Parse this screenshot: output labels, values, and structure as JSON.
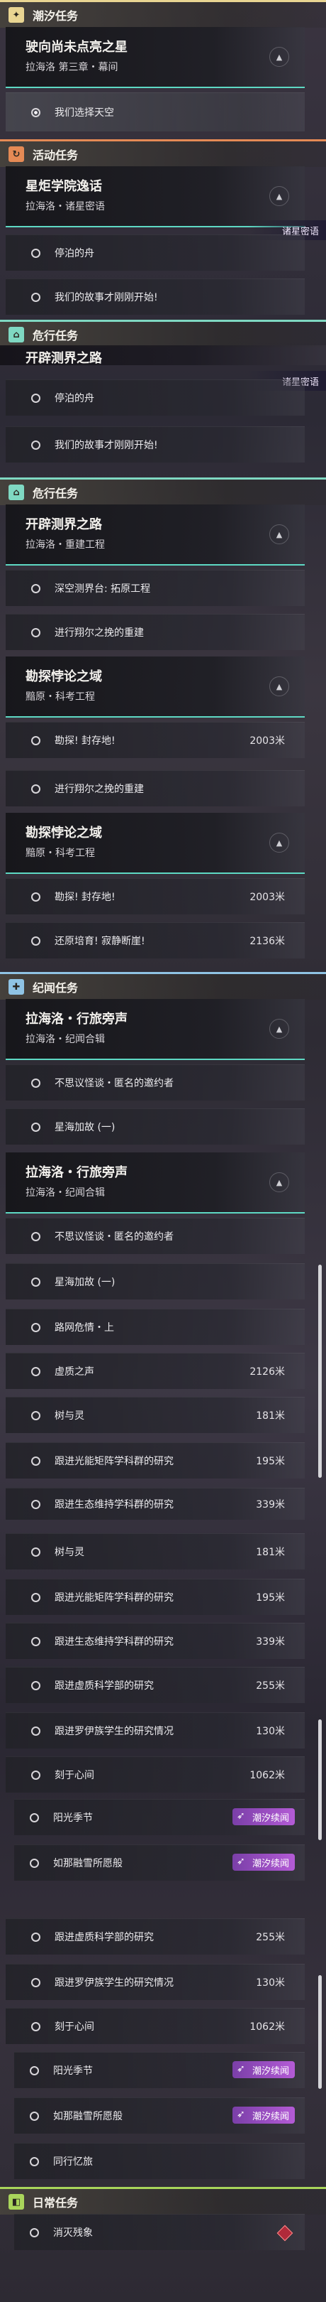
{
  "sections": {
    "tide": {
      "title": "潮汐任务",
      "icon": "✦"
    },
    "activity": {
      "title": "活动任务",
      "icon": "↻"
    },
    "danger": {
      "title": "危行任务",
      "icon": "⌂"
    },
    "chronicle": {
      "title": "纪闻任务",
      "icon": "✚"
    },
    "daily": {
      "title": "日常任务",
      "icon": "◧"
    }
  },
  "cards": {
    "c1": {
      "title": "驶向尚未点亮之星",
      "sub": "拉海洛 第三章・幕间"
    },
    "c2": {
      "title": "星炬学院逸话",
      "sub": "拉海洛・诸星密语"
    },
    "c3": {
      "title": "开辟测界之路",
      "sub": "拉海洛・重建工程"
    },
    "c4": {
      "title": "勘探悖论之域",
      "sub": "黯原・科考工程"
    },
    "c5": {
      "title": "勘探悖论之域",
      "sub": "黯原・科考工程"
    },
    "c6": {
      "title": "拉海洛・行旅旁声",
      "sub": "拉海洛・纪闻合辑"
    },
    "c7": {
      "title": "拉海洛・行旅旁声",
      "sub": "拉海洛・纪闻合辑"
    }
  },
  "partial": {
    "kaipi": "开辟测界之路",
    "xingyu": "诸星密语"
  },
  "rows": {
    "r_choose": "我们选择天空",
    "r_boat": "停泊的舟",
    "r_story": "我们的故事才刚刚开始!",
    "r_deep": "深空测界台: 拓原工程",
    "r_rebuild": "进行翔尔之挽的重建",
    "r_explore": "勘探! 封存地!",
    "r_ruins": "还原培育! 寂静断崖!",
    "r_rumor": "不思议怪谈・匿名的邀约者",
    "r_star": "星海加故 (一)",
    "r_road": "路网危情・上",
    "r_void": "虚质之声",
    "r_tree": "树与灵",
    "r_light": "跟进光能矩阵学科群的研究",
    "r_eco": "跟进生态维持学科群的研究",
    "r_void2": "跟进虚质科学部的研究",
    "r_luo": "跟进罗伊族学生的研究情况",
    "r_heart": "刻于心间",
    "r_sun": "阳光季节",
    "r_snow": "如那融雪所愿般",
    "r_walk": "同行忆旅",
    "r_clear": "消灭残象"
  },
  "dist": {
    "d2003": "2003米",
    "d2136": "2136米",
    "d2126": "2126米",
    "d181": "181米",
    "d195": "195米",
    "d339": "339米",
    "d255": "255米",
    "d130": "130米",
    "d1062": "1062米"
  },
  "badge": "潮汐续闻",
  "colors": {
    "tide": "#e9d592",
    "activity": "#e58a55",
    "danger": "#7fd8c2",
    "chronicle": "#8fc3e4",
    "daily": "#a9d55b"
  }
}
